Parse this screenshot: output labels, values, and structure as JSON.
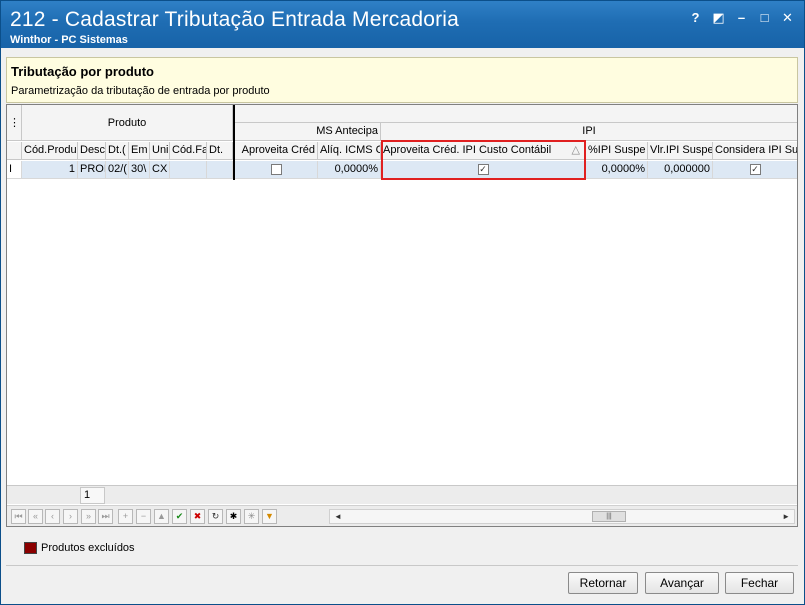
{
  "window": {
    "title": "212 - Cadastrar Tributação Entrada Mercadoria",
    "subtitle": "Winthor - PC Sistemas",
    "controls": {
      "help": "?",
      "restore": "◩",
      "minimize": "–",
      "maximize": "□",
      "close": "✕"
    }
  },
  "header": {
    "title": "Tributação por produto",
    "description": "Parametrização da tributação de entrada por produto"
  },
  "grid": {
    "corner_icon": "⋮",
    "bands": {
      "produto": "Produto",
      "icms_antecipado": "MS Antecipa",
      "ipi": "IPI"
    },
    "columns": {
      "cod_produto": "Cód.Produ",
      "descricao": "Desc",
      "dt": "Dt.(",
      "em": "Em",
      "unidade": "Uni",
      "cod_fab": "Cód.Fa",
      "dt2": "Dt.",
      "aproveita_cred": "Aproveita Créd",
      "aliq_icms": "Alíq. ICMS C",
      "aproveita_cred_ipi": "Aproveita Créd. IPI Custo Contábil",
      "sort_icon": "△",
      "perc_ipi_susp": "%IPI Suspe",
      "vlr_ipi_susp": "Vlr.IPI Suspe",
      "considera_ipi": "Considera IPI Su"
    },
    "rows": [
      {
        "indicator": "I",
        "cod_produto": "1",
        "descricao": "PROI",
        "dt": "02/(",
        "em": "30\\",
        "unidade": "CX",
        "cod_fab": "",
        "dt2": "",
        "aproveita_cred": false,
        "aliq_icms": "0,0000%",
        "aproveita_cred_ipi": true,
        "perc_ipi_susp": "0,0000%",
        "vlr_ipi_susp": "0,000000",
        "considera_ipi": true
      }
    ],
    "footer_count": "1"
  },
  "legend": {
    "label": "Produtos excluídos",
    "color": "#8b0000"
  },
  "buttons": {
    "retornar": "Retornar",
    "avancar": "Avançar",
    "fechar": "Fechar"
  },
  "colors": {
    "titlebar": "#1f6db3",
    "header_bg": "#fffde0",
    "selected_row": "#dde8f4",
    "highlight_border": "#e02020"
  }
}
